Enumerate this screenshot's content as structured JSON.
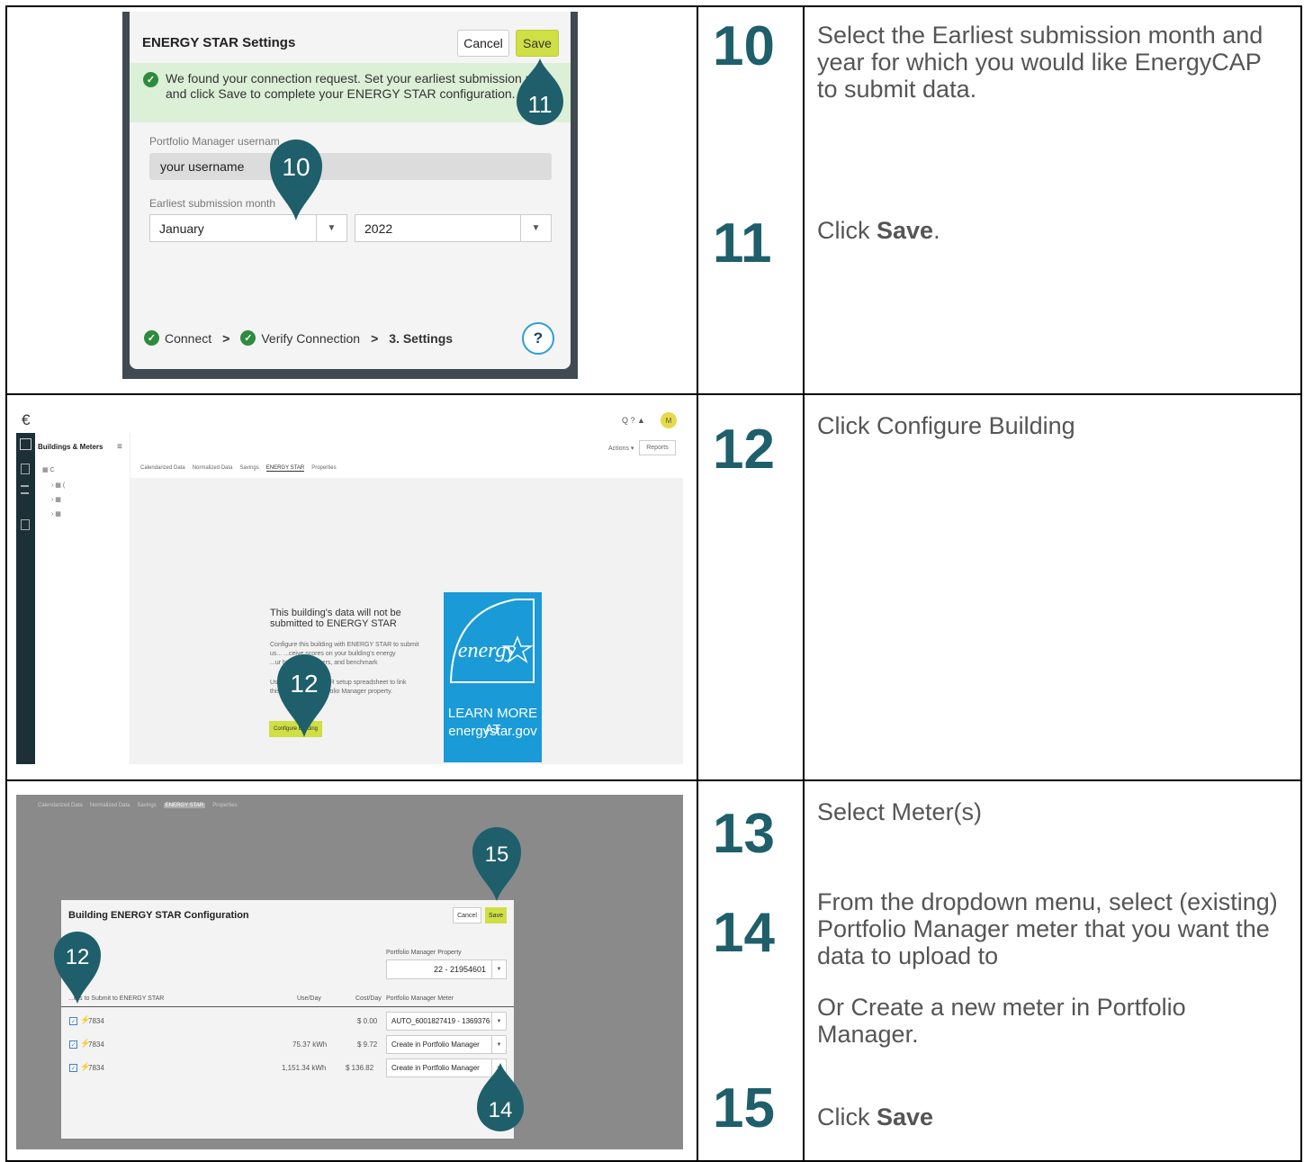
{
  "rows": [
    {
      "steps": [
        {
          "number": "10",
          "text": "Select the Earliest submission month and year for which you would like EnergyCAP to submit data."
        },
        {
          "number": "11",
          "text_before": "Click ",
          "text_bold": "Save",
          "text_after": "."
        }
      ],
      "screenshot": {
        "dialog_title": "ENERGY STAR Settings",
        "cancel_label": "Cancel",
        "save_label": "Save",
        "banner_text": "We found your connection request. Set your earliest submission m and click Save to complete your ENERGY STAR configuration.",
        "username_label": "Portfolio Manager usernam",
        "username_value": "your username",
        "month_label": "Earliest submission month",
        "month_value": "January",
        "year_value": "2022",
        "step_connect": "Connect",
        "step_verify": "Verify Connection",
        "step_settings": "3. Settings",
        "help_label": "?",
        "pin_10": "10",
        "pin_11": "11"
      }
    },
    {
      "steps": [
        {
          "number": "12",
          "text": "Click Configure Building"
        }
      ],
      "screenshot": {
        "app_logo": "€",
        "section_title": "Buildings & Meters",
        "tabs": [
          "Calendarized Data",
          "Normalized Data",
          "Savings",
          "ENERGY STAR",
          "Properties"
        ],
        "actions_label": "Actions",
        "reports_label": "Reports",
        "header_icons": "Q ? ▲",
        "avatar": "M",
        "message_title": "This building's data will not be submitted to ENERGY STAR",
        "message_body_1": "Configure this building with ENERGY STAR to submit",
        "message_body_2": "us... ...ceive scores on your building's energy",
        "message_body_3": "...ur building to others, and benchmark",
        "message_body_4": "Use ... ENERGY STAR setup spreadsheet to link",
        "message_body_5": "this bu... to your Portfolio Manager property.",
        "configure_button": "Configure Building",
        "energy_logo_script": "energy",
        "learn_more_1": "LEARN MORE AT",
        "learn_more_2": "energystar.gov",
        "pin_12": "12"
      }
    },
    {
      "steps": [
        {
          "number": "13",
          "text": "Select Meter(s)"
        },
        {
          "number": "14",
          "text": "From the dropdown menu, select (existing) Portfolio Manager meter that you want the data to upload to",
          "text2": "Or Create a new meter in Portfolio Manager."
        },
        {
          "number": "15",
          "text_before": "Click ",
          "text_bold": "Save",
          "text_after": ""
        }
      ],
      "screenshot": {
        "tabs": [
          "Calendarized Data",
          "Normalized Data",
          "Savings",
          "ENERGY STAR",
          "Properties"
        ],
        "dialog_title": "Building ENERGY STAR Configuration",
        "cancel_label": "Cancel",
        "save_label": "Save",
        "property_label": "Portfolio Manager Property",
        "property_value": "22 - 21954601",
        "col_meters": "...ers to Submit to ENERGY STAR",
        "col_use": "Use/Day",
        "col_cost": "Cost/Day",
        "col_pm_meter": "Portfolio Manager Meter",
        "meter_rows": [
          {
            "id": "7834",
            "use": "",
            "cost": "$ 0.00",
            "pm_meter": "AUTO_6001827419 - 1369376"
          },
          {
            "id": "7834",
            "use": "75.37 kWh",
            "cost": "$ 9.72",
            "pm_meter": "Create in Portfolio Manager"
          },
          {
            "id": "7834",
            "use": "1,151.34 kWh",
            "cost": "$ 136.82",
            "pm_meter": "Create in Portfolio Manager"
          }
        ],
        "pin_12": "12",
        "pin_14": "14",
        "pin_15": "15"
      }
    }
  ]
}
